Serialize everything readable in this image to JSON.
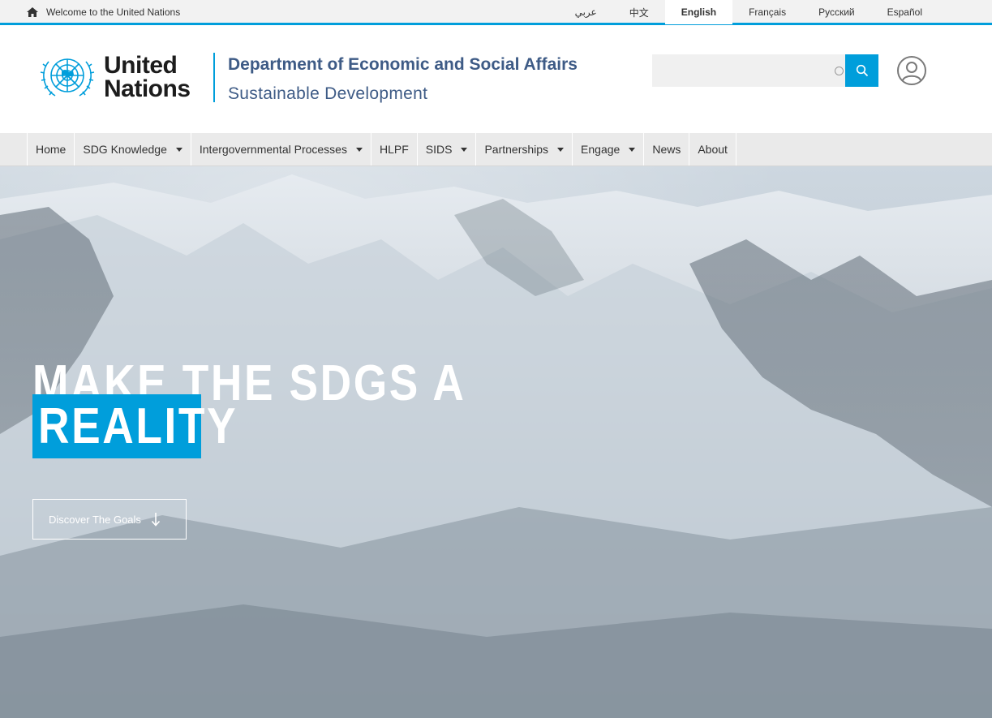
{
  "topbar": {
    "welcome": "Welcome to the United Nations",
    "languages": [
      {
        "label": "عربي",
        "active": false
      },
      {
        "label": "中文",
        "active": false
      },
      {
        "label": "English",
        "active": true
      },
      {
        "label": "Français",
        "active": false
      },
      {
        "label": "Русский",
        "active": false
      },
      {
        "label": "Español",
        "active": false
      }
    ]
  },
  "header": {
    "logo_line1": "United",
    "logo_line2": "Nations",
    "department": "Department of Economic and Social Affairs",
    "subtitle": "Sustainable Development",
    "search_placeholder": ""
  },
  "nav": {
    "items": [
      {
        "label": "Home",
        "dropdown": false
      },
      {
        "label": "SDG Knowledge",
        "dropdown": true
      },
      {
        "label": "Intergovernmental Processes",
        "dropdown": true
      },
      {
        "label": "HLPF",
        "dropdown": false
      },
      {
        "label": "SIDS",
        "dropdown": true
      },
      {
        "label": "Partnerships",
        "dropdown": true
      },
      {
        "label": "Engage",
        "dropdown": true
      },
      {
        "label": "News",
        "dropdown": false
      },
      {
        "label": "About",
        "dropdown": false
      }
    ]
  },
  "hero": {
    "headline_line1": "MAKE THE SDGS A",
    "headline_line2": "REALITY",
    "cta_label": "Discover The Goals"
  },
  "colors": {
    "accent": "#009edb",
    "department_text": "#3e5b86"
  },
  "icons": [
    "home-icon",
    "un-emblem-icon",
    "search-icon",
    "user-icon",
    "arrow-down-icon"
  ]
}
